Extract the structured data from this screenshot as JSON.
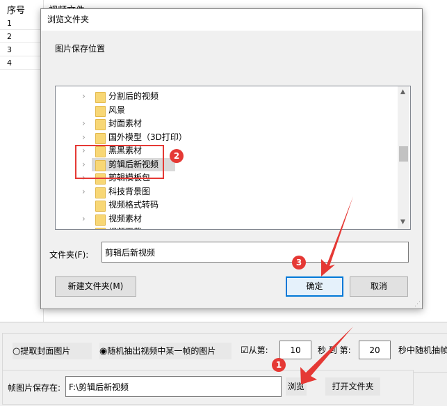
{
  "table": {
    "columns": [
      "序号",
      "视频文件"
    ],
    "rows": [
      "1",
      "2",
      "3",
      "4"
    ]
  },
  "dialog": {
    "title": "浏览文件夹",
    "description": "图片保存位置",
    "tree": [
      {
        "label": "分割后的视频",
        "expandable": true
      },
      {
        "label": "风景",
        "expandable": false
      },
      {
        "label": "封面素材",
        "expandable": true
      },
      {
        "label": "国外模型（3D打印）",
        "expandable": true
      },
      {
        "label": "黑黑素材",
        "expandable": true
      },
      {
        "label": "剪辑后新视频",
        "expandable": true,
        "selected": true
      },
      {
        "label": "剪辑模板包",
        "expandable": true
      },
      {
        "label": "科技背景图",
        "expandable": true
      },
      {
        "label": "视频格式转码",
        "expandable": false
      },
      {
        "label": "视频素材",
        "expandable": true
      },
      {
        "label": "视频下载",
        "expandable": true
      }
    ],
    "folder_label": "文件夹(F):",
    "folder_value": "剪辑后新视频",
    "new_folder_button": "新建文件夹(M)",
    "ok_button": "确定",
    "cancel_button": "取消"
  },
  "options": {
    "radio_cover": "提取封面图片",
    "radio_random": "随机抽出视频中某一帧的图片",
    "selected_radio": "random",
    "checkbox_from": "从第:",
    "checkbox_checked": true,
    "from_value": "10",
    "sec_to": "秒 到 第:",
    "to_value": "20",
    "suffix": "秒中随机抽帧"
  },
  "save": {
    "label": "帧图片保存在:",
    "path": "F:\\剪辑后新视频",
    "browse_button": "浏览",
    "open_folder_button": "打开文件夹"
  },
  "annotations": {
    "badges": [
      "1",
      "2",
      "3"
    ],
    "color": "#e53935"
  }
}
